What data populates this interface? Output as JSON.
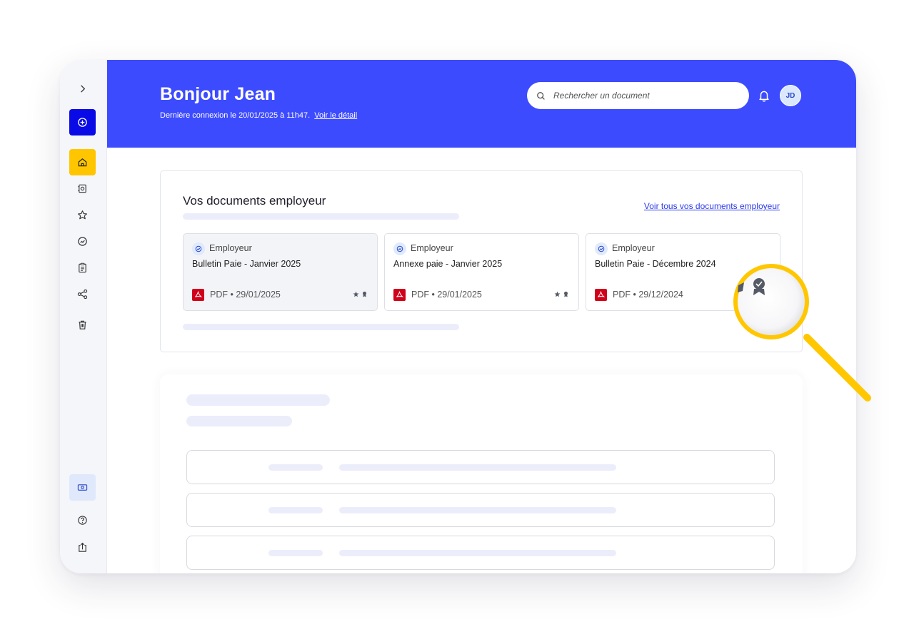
{
  "header": {
    "greeting": "Bonjour Jean",
    "last_login_text": "Dernière connexion le 20/01/2025 à 11h47.",
    "last_login_link": "Voir le détail",
    "avatar_initials": "JD",
    "accent_color": "#3d4bff"
  },
  "search": {
    "placeholder": "Rechercher un document"
  },
  "sidebar": {
    "items": [
      {
        "name": "expand",
        "icon": "chevron-right-icon"
      },
      {
        "name": "add",
        "icon": "plus-circle-icon"
      },
      {
        "name": "home",
        "icon": "home-icon",
        "active": true
      },
      {
        "name": "scan",
        "icon": "scan-icon"
      },
      {
        "name": "favorites",
        "icon": "star-icon"
      },
      {
        "name": "dashboard",
        "icon": "gauge-icon"
      },
      {
        "name": "tasks",
        "icon": "clipboard-icon"
      },
      {
        "name": "share",
        "icon": "share-icon"
      },
      {
        "name": "trash",
        "icon": "trash-icon"
      },
      {
        "name": "wallet",
        "icon": "wallet-icon"
      },
      {
        "name": "help",
        "icon": "help-icon"
      },
      {
        "name": "export",
        "icon": "export-icon"
      }
    ]
  },
  "employer_docs": {
    "title": "Vos documents employeur",
    "see_all_link": "Voir tous vos documents employeur",
    "documents": [
      {
        "category": "Employeur",
        "name": "Bulletin Paie - Janvier 2025",
        "meta": "PDF • 29/01/2025"
      },
      {
        "category": "Employeur",
        "name": "Annexe paie - Janvier 2025",
        "meta": "PDF • 29/01/2025"
      },
      {
        "category": "Employeur",
        "name": "Bulletin Paie - Décembre 2024",
        "meta": "PDF • 29/12/2024"
      }
    ]
  },
  "colors": {
    "sidebar_add": "#0a0ae6",
    "sidebar_home": "#ffc600",
    "magnifier": "#ffc700",
    "pdf": "#d0021b"
  }
}
